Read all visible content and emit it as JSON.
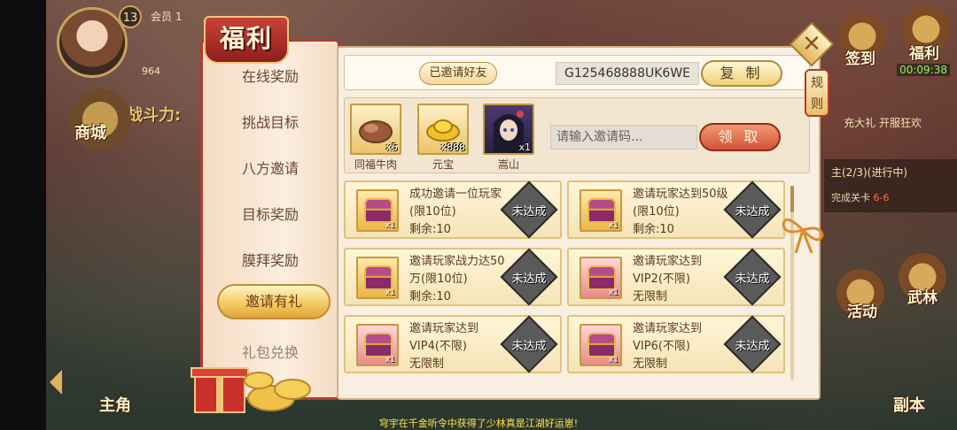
{
  "hud": {
    "level": "13",
    "vip_label": "会员 1",
    "gold": "964",
    "power_label": "战斗力:",
    "timer": "00:09:38"
  },
  "left_menu": [
    {
      "label": "商城"
    }
  ],
  "right_menu": [
    {
      "label": "签到"
    },
    {
      "label": "福利"
    },
    {
      "label": "活动"
    },
    {
      "label": "武林"
    }
  ],
  "quest": {
    "title": "主(2/3)(进行中)",
    "detail": "完成关卡",
    "progress": "6-6"
  },
  "promo": "充大礼 开服狂欢",
  "bottom_nav": [
    {
      "label": "主角"
    },
    {
      "label": "副本"
    }
  ],
  "marquee": "穹宇在千金听令中获得了少林真是江湖好运崽!",
  "dialog": {
    "title": "福利",
    "nav": [
      {
        "label": "在线奖励"
      },
      {
        "label": "挑战目标"
      },
      {
        "label": "八方邀请"
      },
      {
        "label": "目标奖励"
      },
      {
        "label": "膜拜奖励"
      },
      {
        "label": "邀请有礼",
        "active": true
      },
      {
        "label": "礼包兑换"
      }
    ],
    "invited_label": "已邀请好友",
    "invite_code": "G125468888UK6WE",
    "copy_label": "复 制",
    "rewards": [
      {
        "name": "同福牛肉",
        "qty": "x5",
        "icon": "beef-icon"
      },
      {
        "name": "元宝",
        "qty": "x888",
        "icon": "gold-ingot-icon"
      },
      {
        "name": "嵩山",
        "qty": "x1",
        "icon": "hero-portrait-icon"
      }
    ],
    "code_placeholder": "请输入邀请码...",
    "claim_label": "领 取",
    "rules_label": "规则",
    "tasks": [
      {
        "text": "成功邀请一位玩家(限10位)",
        "remaining": "剩余:10",
        "qty": "x1",
        "status": "未达成",
        "pink": false
      },
      {
        "text": "邀请玩家达到50级(限10位)",
        "remaining": "剩余:10",
        "qty": "x1",
        "status": "未达成",
        "pink": false
      },
      {
        "text": "邀请玩家战力达50万(限10位)",
        "remaining": "剩余:10",
        "qty": "x1",
        "status": "未达成",
        "pink": false
      },
      {
        "text": "邀请玩家达到VIP2(不限)",
        "remaining": "无限制",
        "qty": "x1",
        "status": "未达成",
        "pink": true
      },
      {
        "text": "邀请玩家达到VIP4(不限)",
        "remaining": "无限制",
        "qty": "x1",
        "status": "未达成",
        "pink": true
      },
      {
        "text": "邀请玩家达到VIP6(不限)",
        "remaining": "无限制",
        "qty": "x1",
        "status": "未达成",
        "pink": true
      }
    ]
  }
}
